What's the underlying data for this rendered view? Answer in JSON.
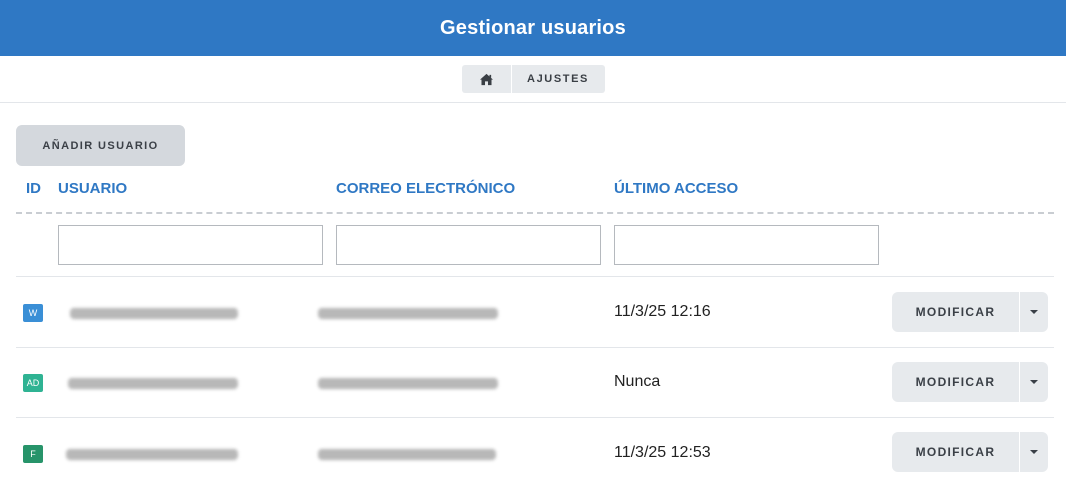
{
  "header": {
    "title": "Gestionar usuarios"
  },
  "breadcrumb": {
    "home_icon": "home-icon",
    "settings_label": "AJUSTES"
  },
  "actions": {
    "add_user_label": "AÑADIR USUARIO"
  },
  "table": {
    "columns": {
      "id": "ID",
      "user": "USUARIO",
      "email": "CORREO ELECTRÓNICO",
      "last_access": "ÚLTIMO ACCESO"
    },
    "filters": {
      "user": "",
      "email": "",
      "last_access": ""
    },
    "rows": [
      {
        "badge": "W",
        "badge_color": "#3a8fd6",
        "last_access": "11/3/25 12:16",
        "action": "MODIFICAR"
      },
      {
        "badge": "AD",
        "badge_color": "#2fb393",
        "last_access": "Nunca",
        "action": "MODIFICAR"
      },
      {
        "badge": "F",
        "badge_color": "#27946a",
        "last_access": "11/3/25 12:53",
        "action": "MODIFICAR"
      }
    ]
  },
  "colors": {
    "primary": "#2f78c4",
    "button_bg": "#e7eaed"
  }
}
